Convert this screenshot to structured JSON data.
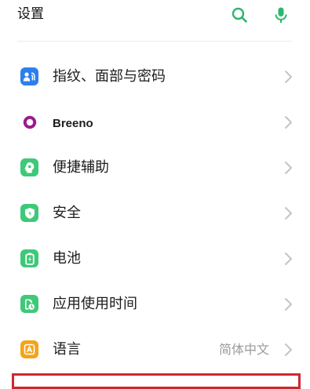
{
  "header": {
    "title": "设置",
    "search_icon": "search-icon",
    "mic_icon": "microphone-icon"
  },
  "colors": {
    "accent": "#2cb66e",
    "blue_tile": "#2d7ff0",
    "purple_ring": "#9b1a8f",
    "green_tile": "#3ec978",
    "amber_tile": "#f4a41a",
    "highlight_border": "#d0272f",
    "chevron": "#c4c4c4"
  },
  "settings": [
    {
      "label": "指纹、面部与密码",
      "icon": "fingerprint-face-icon",
      "value": ""
    },
    {
      "label": "Breeno",
      "icon": "breeno-icon",
      "value": ""
    },
    {
      "label": "便捷辅助",
      "icon": "assist-icon",
      "value": ""
    },
    {
      "label": "安全",
      "icon": "shield-icon",
      "value": ""
    },
    {
      "label": "电池",
      "icon": "battery-icon",
      "value": ""
    },
    {
      "label": "应用使用时间",
      "icon": "usage-time-icon",
      "value": ""
    },
    {
      "label": "语言",
      "icon": "language-icon",
      "value": "简体中文"
    }
  ]
}
